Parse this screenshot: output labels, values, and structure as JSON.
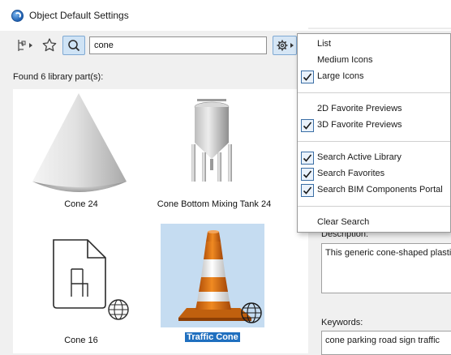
{
  "window": {
    "title": "Object Default Settings"
  },
  "toolbar": {
    "search_value": "cone"
  },
  "results": {
    "found_label": "Found 6 library part(s):"
  },
  "library_items": [
    {
      "name": "Cone 24"
    },
    {
      "name": "Cone Bottom Mixing Tank 24"
    },
    {
      "name": "Cone 16"
    },
    {
      "name": "Traffic Cone",
      "selected": true
    }
  ],
  "details": {
    "description_label": "Description:",
    "description_text": "This generic cone-shaped plastic",
    "keywords_label": "Keywords:",
    "keywords_text": "cone parking road sign traffic"
  },
  "menu": {
    "items": [
      {
        "label": "List",
        "checked": false
      },
      {
        "label": "Medium Icons",
        "checked": false
      },
      {
        "label": "Large Icons",
        "checked": true
      },
      {
        "label": "2D Favorite Previews",
        "checked": false
      },
      {
        "label": "3D Favorite Previews",
        "checked": true
      },
      {
        "label": "Search Active Library",
        "checked": true
      },
      {
        "label": "Search Favorites",
        "checked": true
      },
      {
        "label": "Search BIM Components Portal",
        "checked": true
      },
      {
        "label": "Clear Search",
        "checked": false
      }
    ]
  },
  "colors": {
    "accent": "#1f6fbf",
    "selection": "#c5dcf1",
    "cone_orange": "#e07a16"
  }
}
